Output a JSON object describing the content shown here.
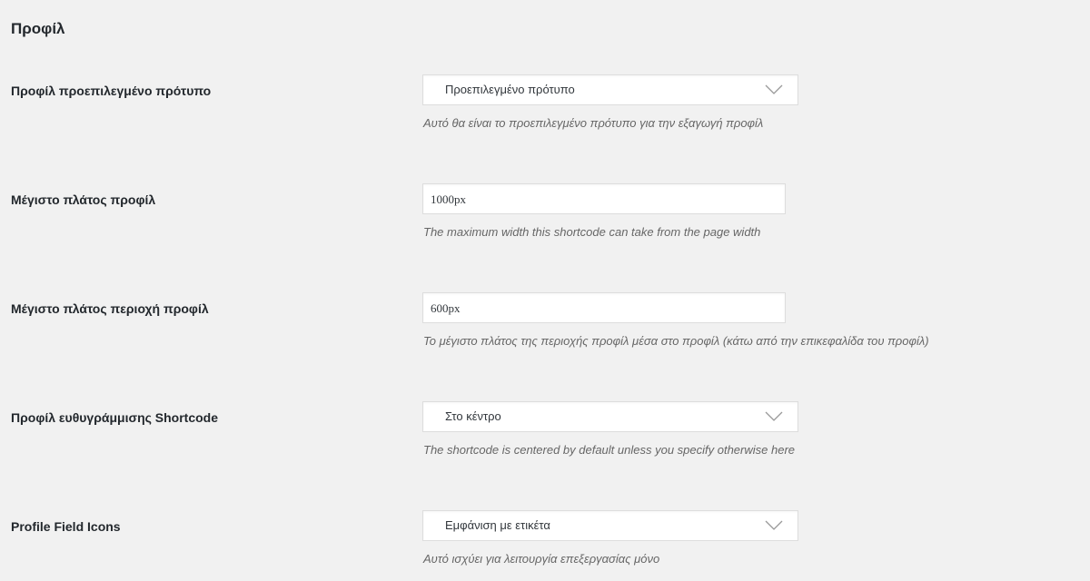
{
  "section": {
    "title": "Προφίλ"
  },
  "fields": [
    {
      "label": "Προφίλ προεπιλεγμένο πρότυπο",
      "type": "select",
      "value": "Προεπιλεγμένο πρότυπο",
      "description": "Αυτό θα είναι το προεπιλεγμένο πρότυπο για την εξαγωγή προφίλ",
      "icon": "chevron-down-icon"
    },
    {
      "label": "Μέγιστο πλάτος προφίλ",
      "type": "text",
      "value": "1000px",
      "description": "The maximum width this shortcode can take from the page width"
    },
    {
      "label": "Μέγιστο πλάτος περιοχή προφίλ",
      "type": "text",
      "value": "600px",
      "description": "Το μέγιστο πλάτος της περιοχής προφίλ μέσα στο προφίλ (κάτω από την επικεφαλίδα του προφίλ)"
    },
    {
      "label": "Προφίλ ευθυγράμμισης Shortcode",
      "type": "select",
      "value": "Στο κέντρο",
      "description": "The shortcode is centered by default unless you specify otherwise here",
      "icon": "chevron-down-icon"
    },
    {
      "label": "Profile Field Icons",
      "type": "select",
      "value": "Εμφάνιση με ετικέτα",
      "description": "Αυτό ισχύει για λειτουργία επεξεργασίας μόνο",
      "icon": "chevron-down-icon"
    }
  ],
  "colors": {
    "background": "#f1f1f1",
    "label": "#23282d",
    "description": "#666666",
    "control_border": "#dddddd"
  }
}
